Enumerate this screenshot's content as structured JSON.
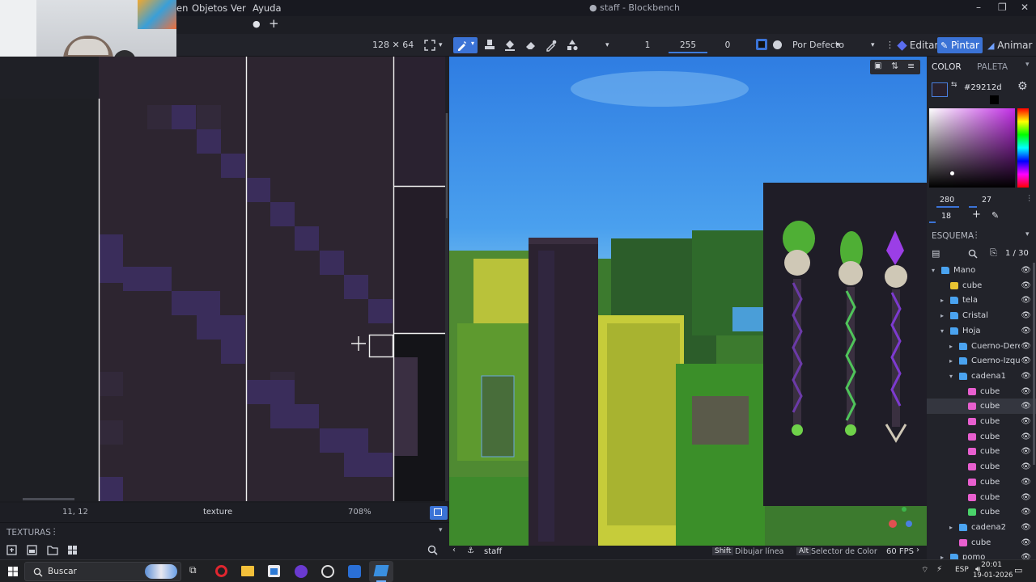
{
  "window": {
    "title": "● staff - Blockbench",
    "menus": [
      "en",
      "Objetos",
      "Ver",
      "Ayuda"
    ],
    "minimize": "–",
    "maximize": "❐",
    "close": "✕"
  },
  "tabs": {
    "dot": "●",
    "add": "+"
  },
  "uv": {
    "size": "128 ✕ 64",
    "coords": "11, 12",
    "texture": "texture",
    "zoom": "708%"
  },
  "toolbar": {
    "size_value": "1",
    "opacity_value": "255",
    "softness_value": "0",
    "blend_mode": "Por Defecto",
    "modes": [
      "Editar",
      "Pintar",
      "Animar"
    ]
  },
  "textures_panel": {
    "title": "TEXTURAS",
    "menu": "⋮"
  },
  "viewport": {
    "tab_label": "staff",
    "shortcut1_key": "Shift",
    "shortcut1_label": "Dibujar línea",
    "shortcut2_key": "Alt",
    "shortcut2_label": "Selector de Color",
    "fps": "60 FPS"
  },
  "color_panel": {
    "tab_color": "COLOR",
    "tab_palette": "PALETA",
    "hex": "#29212d",
    "h": "280",
    "s": "27",
    "v": "18"
  },
  "outliner": {
    "title": "ESQUEMA",
    "count": "1 / 30",
    "rows": [
      {
        "label": "Mano",
        "type": "folder",
        "indent": 0,
        "chev": "▾",
        "selected": false
      },
      {
        "label": "cube",
        "type": "cube-yellow",
        "indent": 1,
        "chev": "",
        "selected": false
      },
      {
        "label": "tela",
        "type": "folder",
        "indent": 1,
        "chev": "▸",
        "selected": false
      },
      {
        "label": "Cristal",
        "type": "folder",
        "indent": 1,
        "chev": "▸",
        "selected": false
      },
      {
        "label": "Hoja",
        "type": "folder",
        "indent": 1,
        "chev": "▾",
        "selected": false
      },
      {
        "label": "Cuerno-Derec",
        "type": "folder",
        "indent": 2,
        "chev": "▸",
        "selected": false
      },
      {
        "label": "Cuerno-Izqui",
        "type": "folder",
        "indent": 2,
        "chev": "▸",
        "selected": false
      },
      {
        "label": "cadena1",
        "type": "folder",
        "indent": 2,
        "chev": "▾",
        "selected": false
      },
      {
        "label": "cube",
        "type": "cube-pink",
        "indent": 3,
        "chev": "",
        "selected": false
      },
      {
        "label": "cube",
        "type": "cube-pink",
        "indent": 3,
        "chev": "",
        "selected": true
      },
      {
        "label": "cube",
        "type": "cube-pink",
        "indent": 3,
        "chev": "",
        "selected": false
      },
      {
        "label": "cube",
        "type": "cube-pink",
        "indent": 3,
        "chev": "",
        "selected": false
      },
      {
        "label": "cube",
        "type": "cube-pink",
        "indent": 3,
        "chev": "",
        "selected": false
      },
      {
        "label": "cube",
        "type": "cube-pink",
        "indent": 3,
        "chev": "",
        "selected": false
      },
      {
        "label": "cube",
        "type": "cube-pink",
        "indent": 3,
        "chev": "",
        "selected": false
      },
      {
        "label": "cube",
        "type": "cube-pink",
        "indent": 3,
        "chev": "",
        "selected": false
      },
      {
        "label": "cube",
        "type": "cube-green",
        "indent": 3,
        "chev": "",
        "selected": false
      },
      {
        "label": "cadena2",
        "type": "folder",
        "indent": 2,
        "chev": "▸",
        "selected": false
      },
      {
        "label": "cube",
        "type": "cube-pink",
        "indent": 2,
        "chev": "",
        "selected": false
      },
      {
        "label": "pomo",
        "type": "folder",
        "indent": 1,
        "chev": "▸",
        "selected": false
      }
    ]
  },
  "taskbar": {
    "search_placeholder": "Buscar",
    "lang": "ESP",
    "time": "20:01",
    "date": "19-01-2026"
  },
  "colors": {
    "accent": "#3b73d6",
    "current_color": "#29212d"
  }
}
